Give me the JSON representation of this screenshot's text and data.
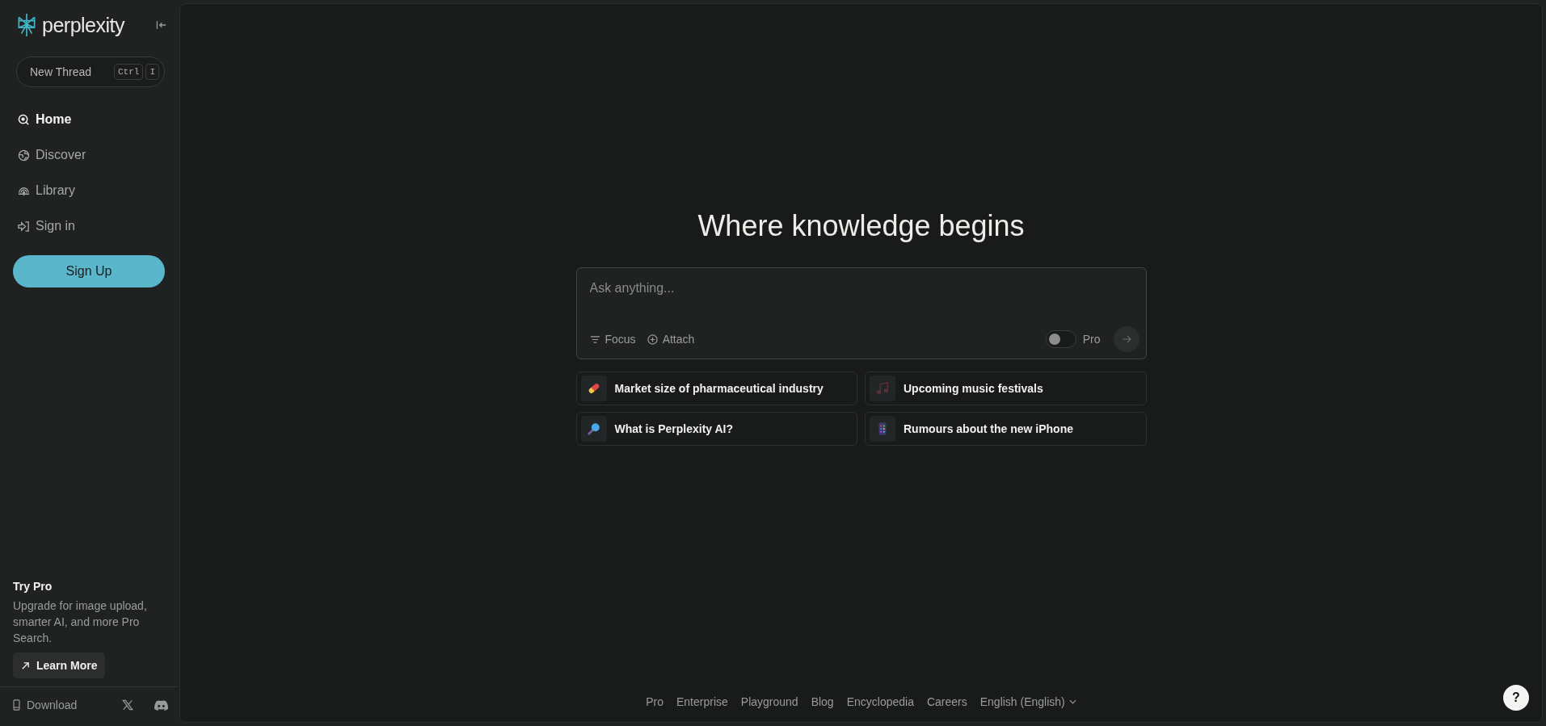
{
  "sidebar": {
    "logo": "perplexity",
    "new_thread": {
      "label": "New Thread",
      "keys": [
        "Ctrl",
        "I"
      ]
    },
    "nav": [
      {
        "label": "Home",
        "kind": "search",
        "selected": true
      },
      {
        "label": "Discover",
        "kind": "globe",
        "selected": false
      },
      {
        "label": "Library",
        "kind": "library",
        "selected": false
      },
      {
        "label": "Sign in",
        "kind": "signin",
        "selected": false
      }
    ],
    "sign_up": "Sign Up",
    "promo": {
      "title": "Try Pro",
      "text": "Upgrade for image upload, smarter AI, and more Pro Search.",
      "button": "Learn More"
    },
    "download": "Download"
  },
  "main": {
    "heading": "Where knowledge begins",
    "search": {
      "placeholder": "Ask anything...",
      "tools": [
        {
          "label": "Focus",
          "kind": "filter"
        },
        {
          "label": "Attach",
          "kind": "attach"
        }
      ],
      "pro_toggle": {
        "label": "Pro",
        "on": false
      }
    },
    "suggestions": [
      {
        "label": "Market size of pharmaceutical industry",
        "kind": "pill"
      },
      {
        "label": "Upcoming music festivals",
        "kind": "music"
      },
      {
        "label": "What is Perplexity AI?",
        "kind": "magnifier"
      },
      {
        "label": "Rumours about the new iPhone",
        "kind": "phone"
      }
    ],
    "footer": {
      "links": [
        "Pro",
        "Enterprise",
        "Playground",
        "Blog",
        "Encyclopedia",
        "Careers"
      ],
      "language": "English (English)"
    },
    "help": "?"
  }
}
